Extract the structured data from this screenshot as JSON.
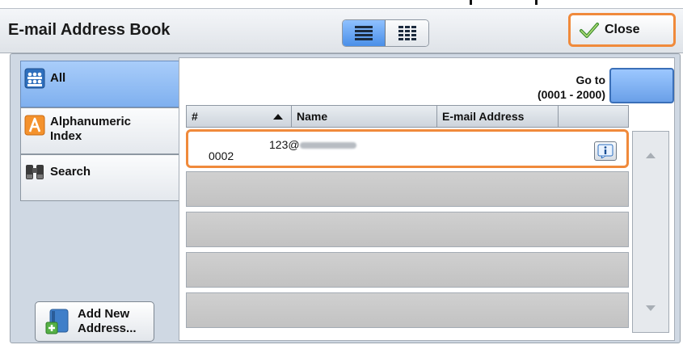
{
  "window": {
    "title": "E-mail Address Book"
  },
  "toolbar": {
    "close_label": "Close"
  },
  "sidebar": {
    "items": [
      {
        "label": "All",
        "active": true
      },
      {
        "label": "Alphanumeric Index",
        "active": false
      },
      {
        "label": "Search",
        "active": false
      }
    ],
    "add_button": "Add New Address..."
  },
  "goto": {
    "label_line1": "Go to",
    "label_line2": "(0001 - 2000)"
  },
  "table": {
    "headers": [
      "#",
      "Name",
      "E-mail Address"
    ],
    "rows": [
      {
        "number": "0002",
        "email": "123@"
      }
    ]
  },
  "colors": {
    "highlight": "#f08a3b",
    "active_tab": "#7fb0ef"
  }
}
